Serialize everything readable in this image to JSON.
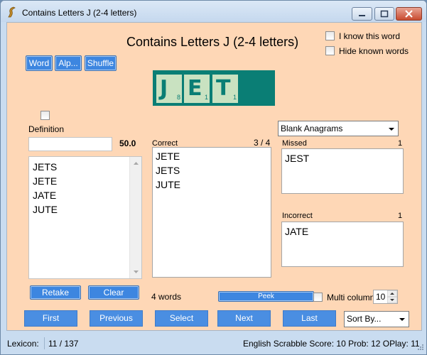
{
  "window": {
    "title": "Contains Letters J (2-4 letters)"
  },
  "heading": "Contains Letters J (2-4 letters)",
  "options": {
    "know_word": "I know this word",
    "hide_known": "Hide known words"
  },
  "buttons": {
    "word": "Word",
    "alpha": "Alp...",
    "shuffle": "Shuffle",
    "retake": "Retake",
    "clear": "Clear",
    "peek": "Peek"
  },
  "tiles": [
    {
      "letter": "J",
      "score": "8"
    },
    {
      "letter": "E",
      "score": "1"
    },
    {
      "letter": "T",
      "score": "1"
    }
  ],
  "definition": {
    "label": "Definition"
  },
  "score_value": "50.0",
  "answer_list": [
    "JETS",
    "JETE",
    "JATE",
    "JUTE"
  ],
  "correct": {
    "label": "Correct",
    "count": "3 / 4",
    "items": [
      "JETE",
      "JETS",
      "JUTE"
    ]
  },
  "mode_select": {
    "value": "Blank Anagrams"
  },
  "missed": {
    "label": "Missed",
    "count": "1",
    "items": [
      "JEST"
    ]
  },
  "incorrect": {
    "label": "Incorrect",
    "count": "1",
    "items": [
      "JATE"
    ]
  },
  "word_count": "4 words",
  "multi_column": {
    "label": "Multi column",
    "value": "10"
  },
  "nav": {
    "first": "First",
    "previous": "Previous",
    "select": "Select",
    "next": "Next",
    "last": "Last"
  },
  "sort_select": {
    "value": "Sort By..."
  },
  "status": {
    "lexicon_label": "Lexicon:",
    "position": "11 / 137",
    "info": "English Scrabble Score: 10 Prob: 12 OPlay: 11"
  },
  "colors": {
    "client_bg": "#fed7b6",
    "tile_bg": "#0a7e75",
    "tile_face": "#c9e2c1",
    "button_blue": "#4a8ee2"
  }
}
